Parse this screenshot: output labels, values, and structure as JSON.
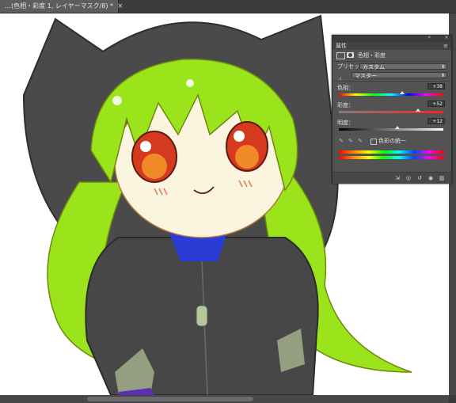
{
  "document_tab": {
    "title": "…(色相・彩度 1, レイヤーマスク/8) *",
    "close_glyph": "×"
  },
  "properties_panel": {
    "panel_title": "属性",
    "collapse_glyph": "»",
    "close_glyph": "×",
    "menu_glyph": "≡",
    "adjustment_name": "色相・彩度",
    "preset": {
      "label": "プリセット：",
      "value": "カスタム"
    },
    "channel": {
      "value": "マスター"
    },
    "hue": {
      "label": "色相：",
      "value": "+38",
      "level": 0.605
    },
    "saturation": {
      "label": "彩度：",
      "value": "+52",
      "level": 0.76
    },
    "lightness": {
      "label": "明度：",
      "value": "+12",
      "level": 0.56
    },
    "colorize": {
      "label": "色彩の統一",
      "checked": false
    },
    "spectrum_colors": [
      "#ff0000",
      "#ffff00",
      "#00ff00",
      "#00ffff",
      "#0000ff",
      "#ff00ff"
    ]
  },
  "canvas": {
    "description_icon": "anime-girl-artwork",
    "hair_color": "#9be31b",
    "hoodie_color": "#464646",
    "eye_color": "#d63a1e"
  }
}
